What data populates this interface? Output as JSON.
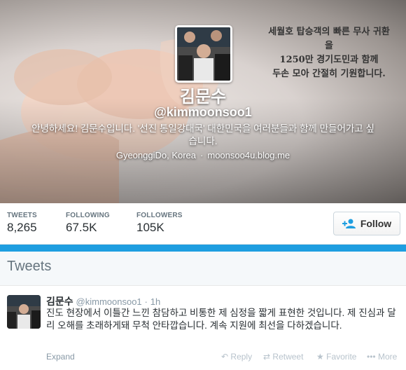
{
  "banner": {
    "lines": [
      "세월호 탑승객의 빠른 무사 귀환을",
      "1250만 경기도민과 함께",
      "두손 모아 간절히 기원합니다."
    ]
  },
  "profile": {
    "name": "김문수",
    "handle": "@kimmoonsoo1",
    "bio": "안녕하세요! 김문수입니다. '선진 통일강대국' 대한민국을 여러분들과 함께 만들어가고 싶습니다.",
    "location": "GyeonggiDo, Korea",
    "website": "moonsoo4u.blog.me",
    "separator": "·"
  },
  "stats": [
    {
      "label": "TWEETS",
      "value": "8,265"
    },
    {
      "label": "FOLLOWING",
      "value": "67.5K"
    },
    {
      "label": "FOLLOWERS",
      "value": "105K"
    }
  ],
  "follow_button": {
    "label": "Follow",
    "icon": "add-user-icon"
  },
  "tweets_header": "Tweets",
  "tweet": {
    "name": "김문수",
    "handle": "@kimmoonsoo1",
    "separator": "·",
    "time": "1h",
    "text": "진도 현장에서 이틀간 느낀 참담하고 비통한 제 심정을 짧게 표현한 것입니다. 제 진심과 달리 오해를 초래하게돼 무척 안타깝습니다. 계속 지원에 최선을 다하겠습니다.",
    "expand": "Expand",
    "actions": [
      {
        "label": "Reply",
        "icon": "reply-icon"
      },
      {
        "label": "Retweet",
        "icon": "retweet-icon"
      },
      {
        "label": "Favorite",
        "icon": "star-icon"
      },
      {
        "label": "More",
        "icon": "more-icon"
      }
    ]
  },
  "colors": {
    "accent": "#1e9ee0",
    "text": "#292f33",
    "muted": "#8899a6"
  }
}
